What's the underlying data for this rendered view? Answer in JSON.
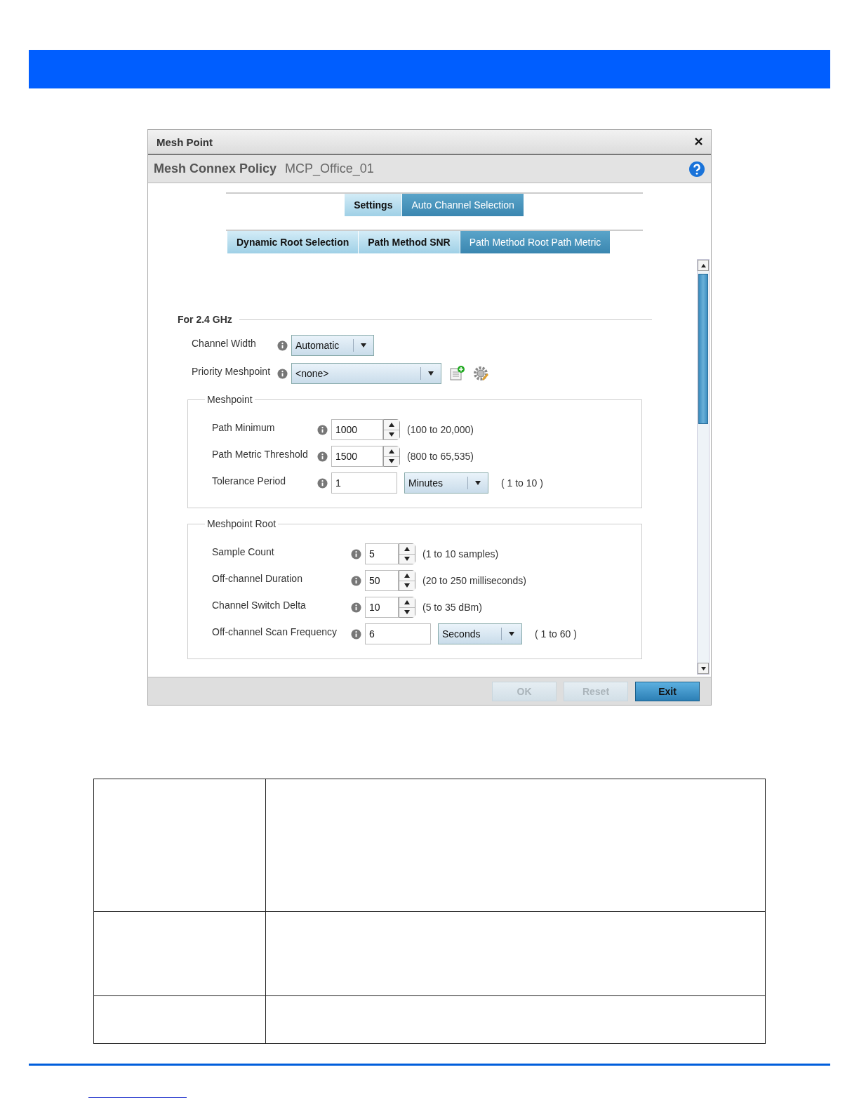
{
  "dialog": {
    "title": "Mesh Point",
    "policy_label": "Mesh Connex Policy",
    "policy_name": "MCP_Office_01"
  },
  "tabs": [
    {
      "label": "Settings",
      "selected": false
    },
    {
      "label": "Auto Channel Selection",
      "selected": true
    }
  ],
  "subtabs": [
    {
      "label": "Dynamic Root Selection",
      "selected": false
    },
    {
      "label": "Path Method SNR",
      "selected": false
    },
    {
      "label": "Path Method Root Path Metric",
      "selected": true
    }
  ],
  "section": {
    "title": "For 2.4 GHz",
    "fields": [
      {
        "label": "Channel Width",
        "kind": "select",
        "value": "Automatic"
      },
      {
        "label": "Priority Meshpoint",
        "kind": "select-wide",
        "value": "<none>"
      }
    ]
  },
  "groups": [
    {
      "title": "Meshpoint",
      "rows": [
        {
          "label": "Path Minimum",
          "kind": "spinner",
          "value": "1000",
          "range": "(100 to 20,000)"
        },
        {
          "label": "Path Metric Threshold",
          "kind": "spinner",
          "value": "1500",
          "range": "(800 to 65,535)"
        },
        {
          "label": "Tolerance Period",
          "kind": "unit",
          "value": "1",
          "unit": "Minutes",
          "range": "( 1 to 10 )"
        }
      ]
    },
    {
      "title": "Meshpoint Root",
      "rows": [
        {
          "label": "Sample Count",
          "kind": "spinner",
          "value": "5",
          "range": "(1 to 10 samples)"
        },
        {
          "label": "Off-channel Duration",
          "kind": "spinner",
          "value": "50",
          "range": "(20 to 250 milliseconds)"
        },
        {
          "label": "Channel Switch Delta",
          "kind": "spinner",
          "value": "10",
          "range": "(5 to 35 dBm)"
        },
        {
          "label": "Off-channel Scan Frequency",
          "kind": "unit",
          "value": "6",
          "unit": "Seconds",
          "range": "( 1 to 60 )"
        }
      ]
    }
  ],
  "buttons": [
    {
      "label": "OK",
      "disabled": true
    },
    {
      "label": "Reset",
      "disabled": true
    },
    {
      "label": "Exit",
      "disabled": false
    }
  ]
}
